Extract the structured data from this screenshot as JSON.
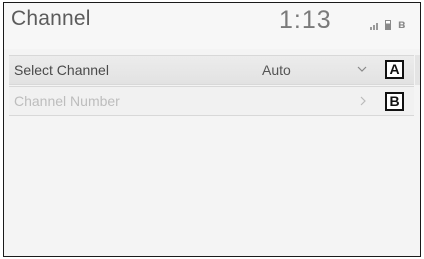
{
  "header": {
    "title": "Channel",
    "clock": "1:13"
  },
  "status_icons": [
    "signal-icon",
    "battery-icon",
    "bluetooth-icon"
  ],
  "rows": [
    {
      "label": "Select Channel",
      "value": "Auto",
      "control": "chevron-down-icon",
      "enabled": true
    },
    {
      "label": "Channel Number",
      "value": "",
      "control": "chevron-right-icon",
      "enabled": false
    }
  ],
  "callouts": [
    "A",
    "B"
  ],
  "colors": {
    "frame": "#1a1a1a",
    "background": "#f4f4f4",
    "enabled_text": "#4a4a4a",
    "disabled_text": "#bdbdbd"
  }
}
